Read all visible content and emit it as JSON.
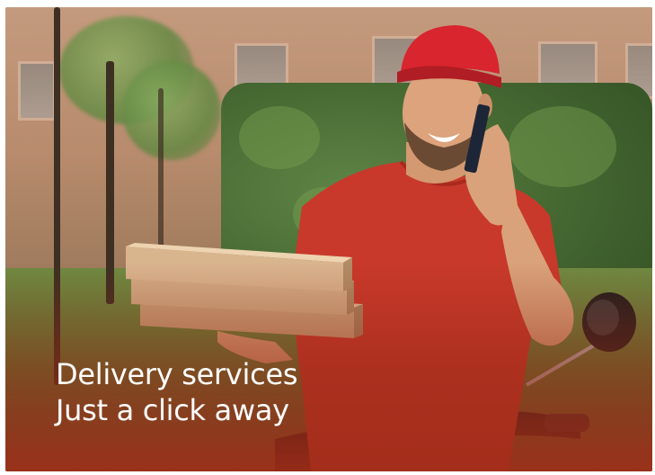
{
  "hero": {
    "caption_line_1": "Delivery services",
    "caption_line_2": "Just a click away"
  },
  "colors": {
    "shirt": "#c8392b",
    "cap": "#d8252e",
    "overlay_bottom": "#a02d19",
    "caption_text": "#ffffff"
  },
  "icons": {
    "phone": "smartphone-icon",
    "scooter": "scooter-icon"
  }
}
